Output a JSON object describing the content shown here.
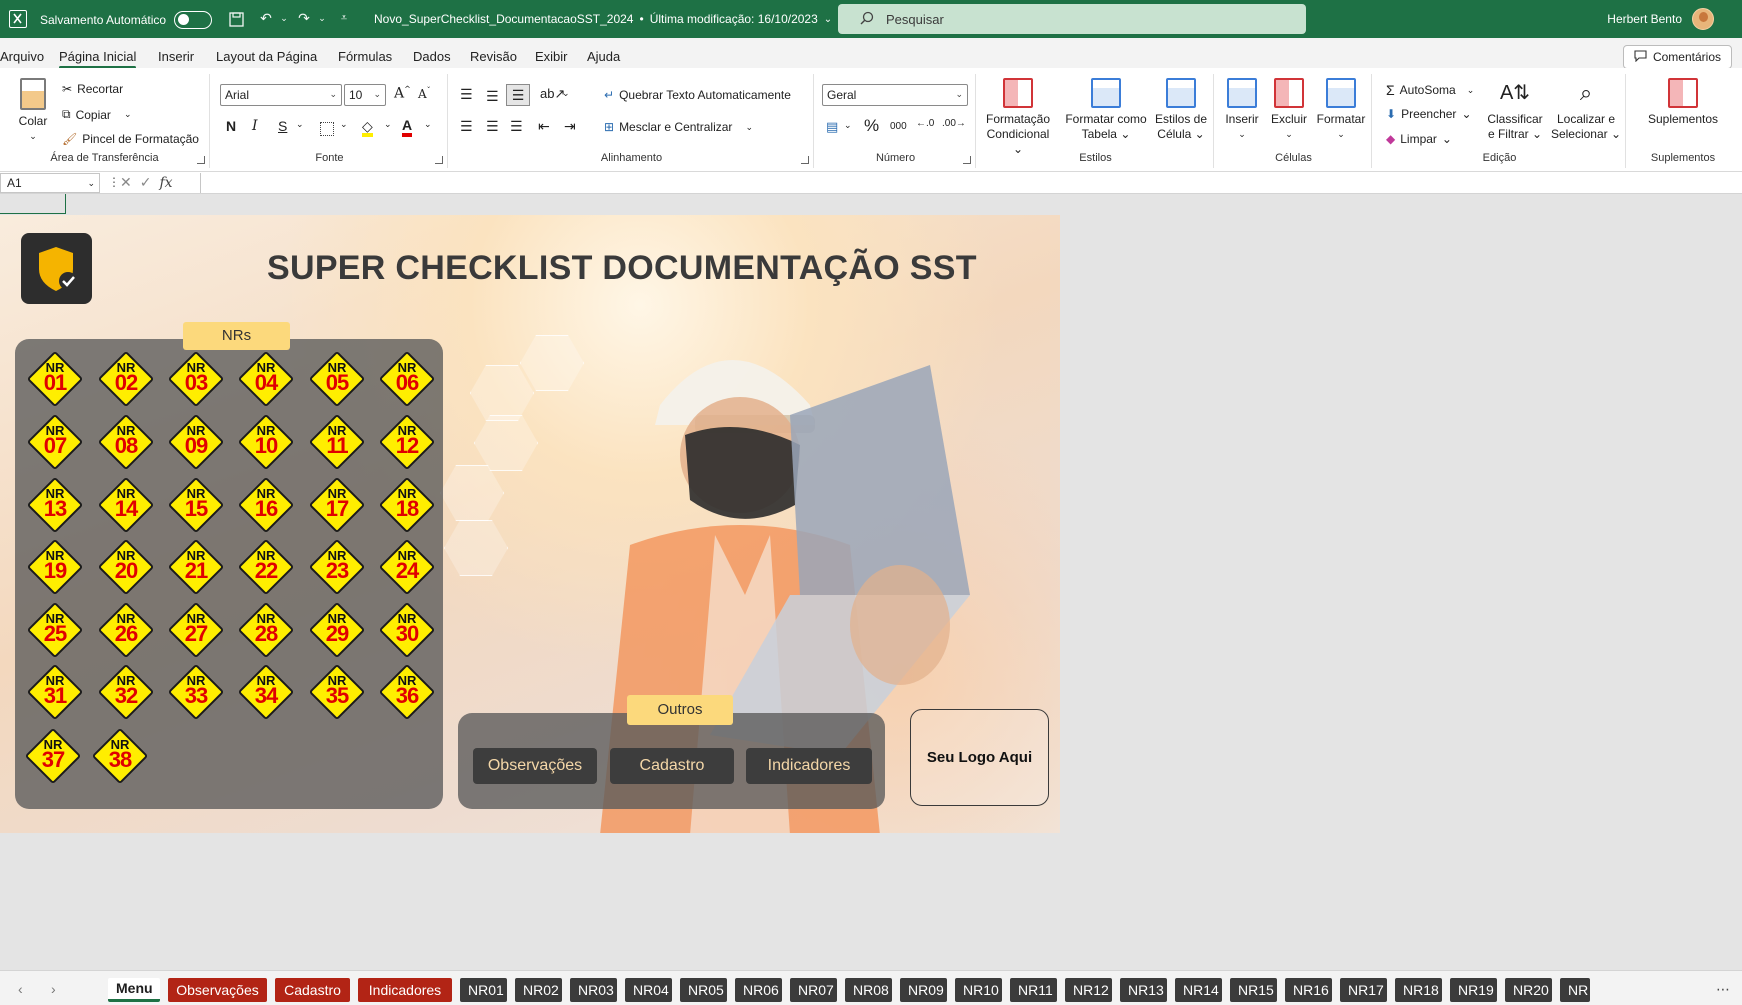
{
  "titlebar": {
    "autosave_label": "Salvamento Automático",
    "file_title": "Novo_SuperChecklist_DocumentacaoSST_2024",
    "separator": "•",
    "modified": "Última modificação: 16/10/2023",
    "search_placeholder": "Pesquisar",
    "user_name": "Herbert Bento"
  },
  "menu": {
    "tabs": [
      "Arquivo",
      "Página Inicial",
      "Inserir",
      "Layout da Página",
      "Fórmulas",
      "Dados",
      "Revisão",
      "Exibir",
      "Ajuda"
    ],
    "active": "Página Inicial",
    "comments": "Comentários"
  },
  "ribbon": {
    "clipboard": {
      "paste": "Colar",
      "cut": "Recortar",
      "copy": "Copiar",
      "format_painter": "Pincel de Formatação",
      "label": "Área de Transferência"
    },
    "font": {
      "name": "Arial",
      "size": "10",
      "bold": "N",
      "italic": "I",
      "underline": "S",
      "label": "Fonte"
    },
    "alignment": {
      "wrap": "Quebrar Texto Automaticamente",
      "merge": "Mesclar e Centralizar",
      "label": "Alinhamento"
    },
    "number": {
      "format": "Geral",
      "percent": "%",
      "thousands": "000",
      "label": "Número"
    },
    "styles": {
      "conditional": "Formatação Condicional",
      "as_table": "Formatar como Tabela",
      "cell_styles": "Estilos de Célula",
      "label": "Estilos"
    },
    "cells": {
      "insert": "Inserir",
      "delete": "Excluir",
      "format": "Formatar",
      "label": "Células"
    },
    "editing": {
      "autosum": "AutoSoma",
      "fill": "Preencher",
      "clear": "Limpar",
      "sort": "Classificar e Filtrar",
      "find": "Localizar e Selecionar",
      "label": "Edição"
    },
    "addins": {
      "addins": "Suplementos",
      "label": "Suplementos"
    }
  },
  "formula_bar": {
    "name_box": "A1",
    "fx": "fx",
    "value": ""
  },
  "dashboard": {
    "title": "SUPER CHECKLIST DOCUMENTAÇÃO SST",
    "nrs_title": "NRs",
    "nr_prefix": "NR",
    "nrs": [
      "01",
      "02",
      "03",
      "04",
      "05",
      "06",
      "07",
      "08",
      "09",
      "10",
      "11",
      "12",
      "13",
      "14",
      "15",
      "16",
      "17",
      "18",
      "19",
      "20",
      "21",
      "22",
      "23",
      "24",
      "25",
      "26",
      "27",
      "28",
      "29",
      "30",
      "31",
      "32",
      "33",
      "34",
      "35",
      "36",
      "37",
      "38"
    ],
    "outros_title": "Outros",
    "outros_buttons": [
      "Observações",
      "Cadastro",
      "Indicadores"
    ],
    "logo_placeholder": "Seu Logo Aqui"
  },
  "sheet_tabs": {
    "active": "Menu",
    "red": [
      "Observações",
      "Cadastro",
      "Indicadores"
    ],
    "dark": [
      "NR01",
      "NR02",
      "NR03",
      "NR04",
      "NR05",
      "NR06",
      "NR07",
      "NR08",
      "NR09",
      "NR10",
      "NR11",
      "NR12",
      "NR13",
      "NR14",
      "NR15",
      "NR16",
      "NR17",
      "NR18",
      "NR19",
      "NR20",
      "NR"
    ]
  },
  "colors": {
    "excel_green": "#1e7145",
    "badge_yellow": "#ffee00",
    "badge_red": "#e00000",
    "panel_gold": "#fcd97c",
    "tab_red": "#b22415"
  }
}
